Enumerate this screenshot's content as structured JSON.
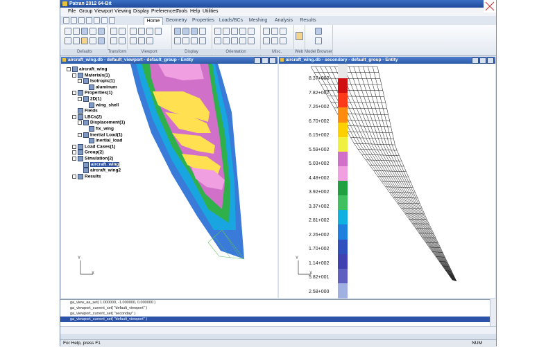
{
  "app": {
    "title": "Patran 2012 64-Bit"
  },
  "menu": [
    "File",
    "Group",
    "Viewport",
    "Viewing",
    "Display",
    "Preferences",
    "Tools",
    "Help",
    "Utilities"
  ],
  "tabs": [
    "Home",
    "Geometry",
    "Properties",
    "Loads/BCs",
    "Meshing",
    "Analysis",
    "Results"
  ],
  "ribbon_groups": [
    "Defaults",
    "Transform",
    "Viewport",
    "Display",
    "Orientation",
    "Misc.",
    "Web",
    "Model Browser"
  ],
  "viewport_left": {
    "title": "aircraft_wing.db - default_viewport - default_group - Entity"
  },
  "viewport_right": {
    "title": "aircraft_wing.db - secondary - default_group - Entity"
  },
  "tree": [
    {
      "label": "aircraft_wing",
      "level": 0,
      "expand": "-"
    },
    {
      "label": "Materials(1)",
      "level": 1,
      "expand": "-"
    },
    {
      "label": "Isotropic(1)",
      "level": 2,
      "expand": "-"
    },
    {
      "label": "aluminum",
      "level": 3,
      "expand": ""
    },
    {
      "label": "Properties(1)",
      "level": 1,
      "expand": "-"
    },
    {
      "label": "2D(1)",
      "level": 2,
      "expand": "-"
    },
    {
      "label": "wing_shell",
      "level": 3,
      "expand": ""
    },
    {
      "label": "Fields",
      "level": 1,
      "expand": ""
    },
    {
      "label": "LBCs(2)",
      "level": 1,
      "expand": "-"
    },
    {
      "label": "Displacement(1)",
      "level": 2,
      "expand": "-"
    },
    {
      "label": "fix_wing",
      "level": 3,
      "expand": ""
    },
    {
      "label": "Inertial Load(1)",
      "level": 2,
      "expand": "-"
    },
    {
      "label": "inertial_load",
      "level": 3,
      "expand": ""
    },
    {
      "label": "Load Cases(1)",
      "level": 1,
      "expand": "+"
    },
    {
      "label": "Group(2)",
      "level": 1,
      "expand": "+"
    },
    {
      "label": "Simulation(2)",
      "level": 1,
      "expand": "-"
    },
    {
      "label": "aircraft_wing",
      "level": 2,
      "expand": "",
      "selected": true
    },
    {
      "label": "aircraft_wing2",
      "level": 2,
      "expand": ""
    },
    {
      "label": "Results",
      "level": 1,
      "expand": "+"
    }
  ],
  "legend": {
    "labels": [
      "8.37+002",
      "7.82+002",
      "7.26+002",
      "6.70+002",
      "6.15+002",
      "5.59+002",
      "5.03+002",
      "4.48+002",
      "3.92+002",
      "3.37+002",
      "2.81+002",
      "2.26+002",
      "1.70+002",
      "1.14+002",
      "5.82+001",
      "2.58+000"
    ],
    "colors": [
      "#e8e8e8",
      "#d01010",
      "#ff3a1a",
      "#ff8c10",
      "#ffd000",
      "#f0f040",
      "#d070c8",
      "#f0a0e0",
      "#20a040",
      "#40c060",
      "#10b0e0",
      "#2080e0",
      "#3050c0",
      "#4040b0",
      "#6060c0",
      "#a0b0e0"
    ]
  },
  "axis": {
    "y": "Y",
    "x": "X"
  },
  "messages": [
    "ga_view_aa_set( 1.000000, -1.000000, 0.000000 )",
    "ga_viewport_current_set( \"default_viewport\" )",
    "ga_viewport_current_set( \"seconday\" )",
    "ga_viewport_current_set( \"default_viewport\" )"
  ],
  "status": {
    "help": "For Help, press F1",
    "num": "NUM"
  }
}
